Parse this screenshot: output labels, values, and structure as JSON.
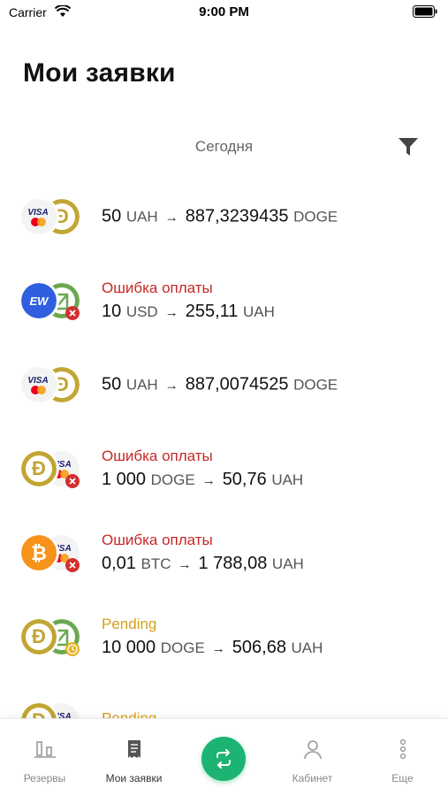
{
  "status_bar": {
    "carrier": "Carrier",
    "time": "9:00 PM"
  },
  "page": {
    "title": "Мои заявки"
  },
  "section": {
    "date": "Сегодня"
  },
  "orders": [
    {
      "status": "",
      "status_type": "none",
      "from_amount": "50",
      "from_cur": "UAH",
      "to_amount": "887,3239435",
      "to_cur": "DOGE",
      "from_icon": "visa-mastercard-icon",
      "to_icon": "doge-icon",
      "badge": "none"
    },
    {
      "status": "Ошибка оплаты",
      "status_type": "error",
      "from_amount": "10",
      "from_cur": "USD",
      "to_amount": "255,11",
      "to_cur": "UAH",
      "from_icon": "ew-icon",
      "to_icon": "privat-icon",
      "badge": "error"
    },
    {
      "status": "",
      "status_type": "none",
      "from_amount": "50",
      "from_cur": "UAH",
      "to_amount": "887,0074525",
      "to_cur": "DOGE",
      "from_icon": "visa-mastercard-icon",
      "to_icon": "doge-icon",
      "badge": "none"
    },
    {
      "status": "Ошибка оплаты",
      "status_type": "error",
      "from_amount": "1 000",
      "from_cur": "DOGE",
      "to_amount": "50,76",
      "to_cur": "UAH",
      "from_icon": "doge-icon",
      "to_icon": "visa-mastercard-icon",
      "badge": "error"
    },
    {
      "status": "Ошибка оплаты",
      "status_type": "error",
      "from_amount": "0,01",
      "from_cur": "BTC",
      "to_amount": "1 788,08",
      "to_cur": "UAH",
      "from_icon": "btc-icon",
      "to_icon": "visa-mastercard-icon",
      "badge": "error"
    },
    {
      "status": "Pending",
      "status_type": "pending",
      "from_amount": "10 000",
      "from_cur": "DOGE",
      "to_amount": "506,68",
      "to_cur": "UAH",
      "from_icon": "doge-icon",
      "to_icon": "privat-icon",
      "badge": "pending"
    },
    {
      "status": "Pending",
      "status_type": "pending",
      "from_amount": "",
      "from_cur": "",
      "to_amount": "",
      "to_cur": "",
      "from_icon": "doge-icon",
      "to_icon": "visa-mastercard-icon",
      "badge": "none"
    }
  ],
  "tabbar": {
    "reserves": "Резервы",
    "my_orders": "Мои заявки",
    "cabinet": "Кабинет",
    "more": "Еще"
  },
  "colors": {
    "accent_green": "#1db372",
    "error_red": "#c62828",
    "pending_yellow": "#d4a017",
    "doge_gold": "#c2a633",
    "btc_orange": "#f7931a",
    "ew_blue": "#2f5fe0",
    "privat_green": "#6aa84f"
  }
}
